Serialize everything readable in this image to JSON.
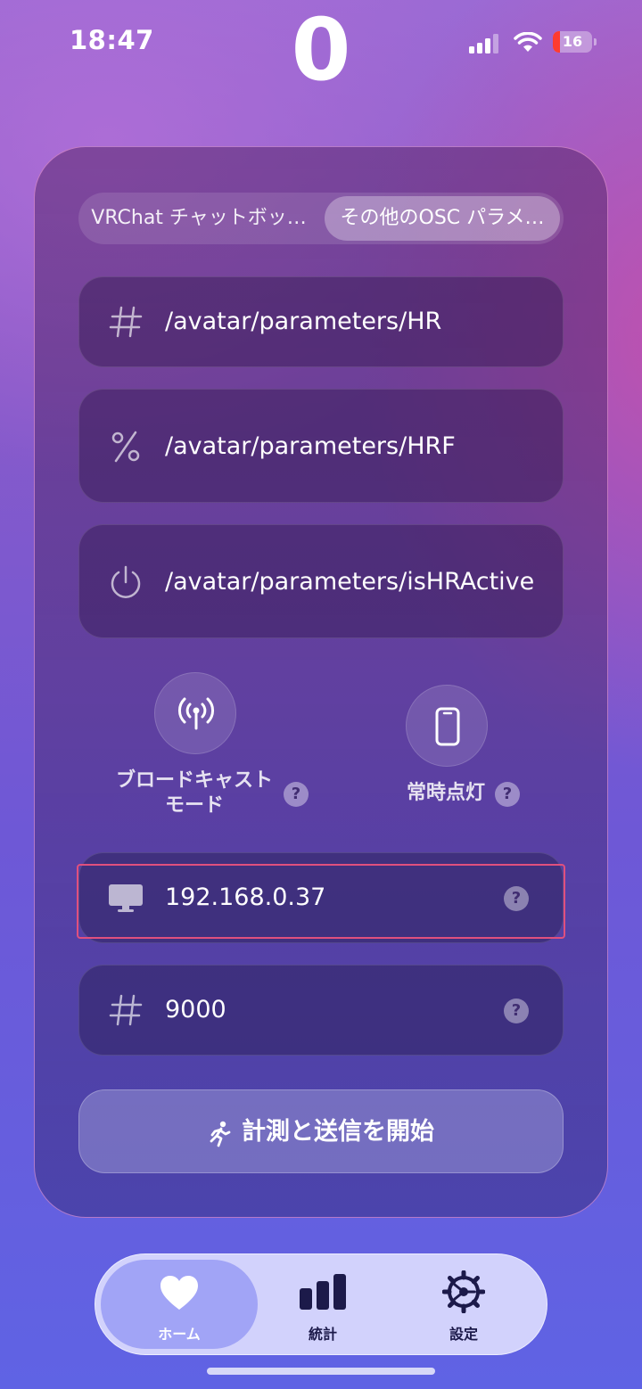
{
  "status_bar": {
    "time": "18:47",
    "battery_percent": "16"
  },
  "heart_rate_display": "0",
  "segments": [
    {
      "label": "VRChat チャットボッ…",
      "selected": false
    },
    {
      "label": "その他のOSC パラメ…",
      "selected": true
    }
  ],
  "osc_params": [
    {
      "icon": "hash-icon",
      "value": "/avatar/parameters/HR"
    },
    {
      "icon": "percent-icon",
      "value": "/avatar/parameters/HRF"
    },
    {
      "icon": "power-icon",
      "value": "/avatar/parameters/isHRActive"
    }
  ],
  "options": {
    "broadcast": {
      "label_line1": "ブロードキャスト",
      "label_line2": "モード",
      "help": "?"
    },
    "always_on": {
      "label": "常時点灯",
      "help": "?"
    }
  },
  "ip_field": {
    "value": "192.168.0.37",
    "help": "?"
  },
  "port_field": {
    "value": "9000",
    "help": "?"
  },
  "start_button": {
    "label": "計測と送信を開始"
  },
  "tabs": [
    {
      "label": "ホーム",
      "icon": "heart-icon",
      "active": true
    },
    {
      "label": "統計",
      "icon": "chart-icon",
      "active": false
    },
    {
      "label": "設定",
      "icon": "gear-icon",
      "active": false
    }
  ],
  "colors": {
    "highlight_border": "#e0507e",
    "battery_low": "#ff3b30"
  }
}
